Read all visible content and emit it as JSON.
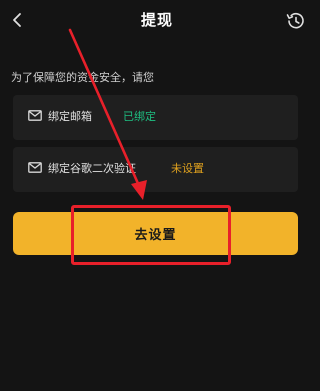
{
  "header": {
    "title": "提现",
    "back_icon": "chevron-left-icon",
    "history_icon": "history-clock-icon"
  },
  "notice": "为了保障您的资金安全，请您",
  "bindings": [
    {
      "icon": "mail-icon",
      "label": "绑定邮箱",
      "status": "已绑定",
      "status_color": "#1fbf82"
    },
    {
      "icon": "mail-icon",
      "label": "绑定谷歌二次验证",
      "status": "未设置",
      "status_color": "#e0a21f"
    }
  ],
  "action": {
    "label": "去设置",
    "color": "#f2b32a"
  },
  "annotation": {
    "color": "#e8202a"
  }
}
